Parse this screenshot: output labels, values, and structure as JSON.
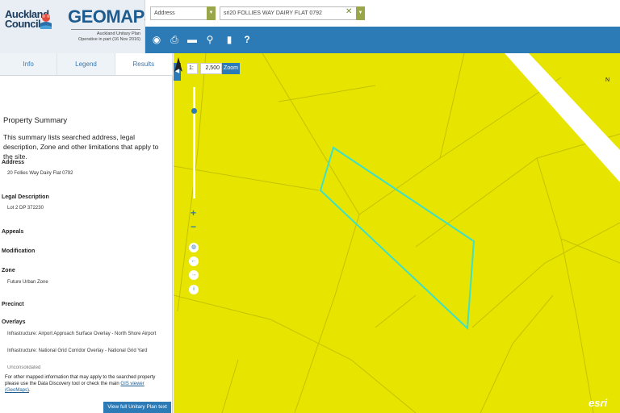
{
  "brand": {
    "council_line1": "Auckland",
    "council_line2": "Council",
    "app_title": "GEOMAPS",
    "subtitle_line1": "Auckland Unitary Plan",
    "subtitle_line2": "Operative in part (16 Nov 2016)"
  },
  "search": {
    "type_value": "Address",
    "address_value": "sri20 FOLLIES WAY DAIRY FLAT 0792"
  },
  "toolbar": {
    "icons": [
      "eye-icon",
      "print-icon",
      "measure-icon",
      "marker-icon",
      "bookmark-icon",
      "help-icon"
    ]
  },
  "tabs": [
    "Info",
    "Legend",
    "Results"
  ],
  "summary": {
    "title": "Property Summary",
    "description": "This summary lists searched address, legal description, Zone and other limitations that apply to the site.",
    "address_label": "Address",
    "address_value": "20 Follies Way Dairy Flat 0792",
    "legal_label": "Legal Description",
    "legal_value": "Lot 2 DP 372230",
    "appeals_label": "Appeals",
    "modification_label": "Modification",
    "zone_label": "Zone",
    "zone_value": "Future Urban Zone",
    "precinct_label": "Precinct",
    "overlays_label": "Overlays",
    "overlay_1": "Infrastructure: Airport Approach Surface Overlay - North Shore Airport",
    "overlay_2": "Infrastructure: National Grid Corridor Overlay - National Grid Yard",
    "overlay_3": "Unconsolidated",
    "footnote": "For other mapped information that may apply to the searched property please use the Data Discovery tool or check the main",
    "footnote_link": "GIS viewer (GeoMaps)",
    "footnote_end": ".",
    "view_button": "View full Unitary Plan text"
  },
  "map": {
    "scale_prefix": "1:",
    "scale_value": "2,500",
    "zoom_button": "Zoom",
    "zoom_in": "+",
    "zoom_out": "−",
    "north_label": "N",
    "esri_label": "esri",
    "zone_color": "#e7e400",
    "parcel_highlight_color": "#3ee0c8"
  }
}
